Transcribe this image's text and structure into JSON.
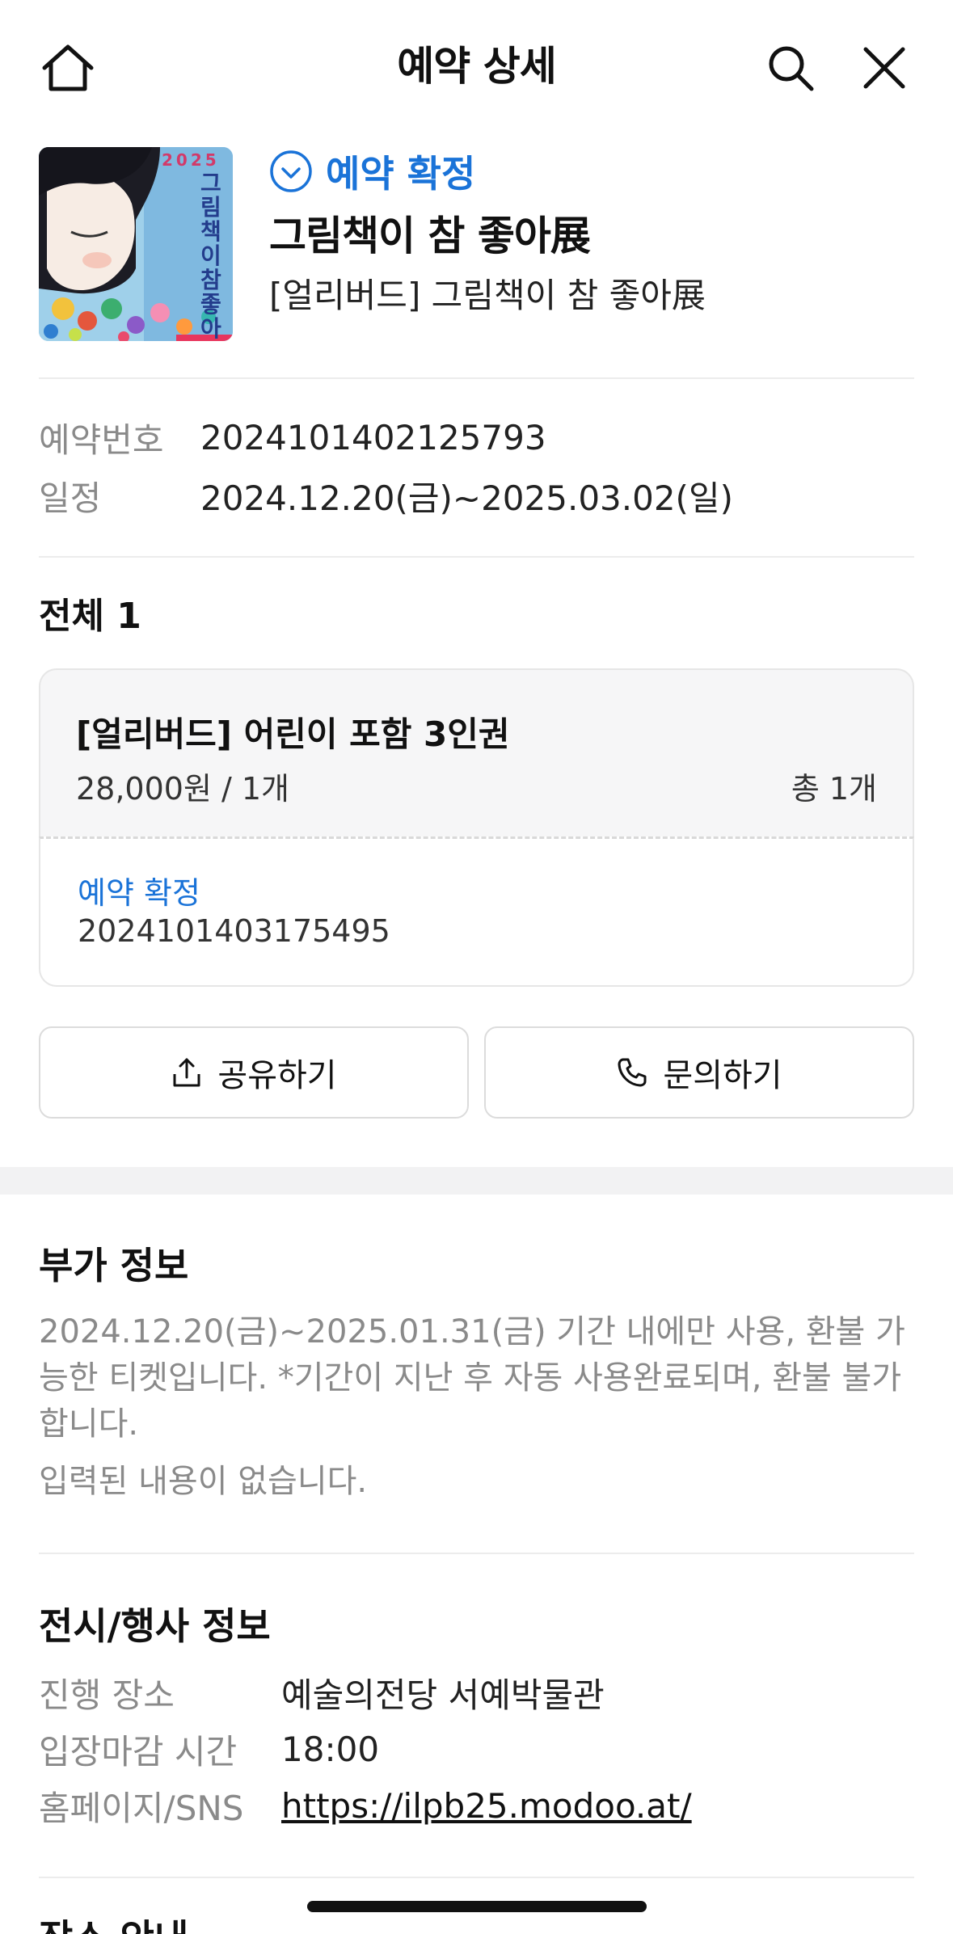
{
  "header": {
    "title": "예약 상세",
    "home_icon": "home-icon",
    "search_icon": "search-icon",
    "close_icon": "close-icon"
  },
  "summary": {
    "status": "예약 확정",
    "status_icon": "check-circle-icon",
    "title": "그림책이 참 좋아展",
    "subtitle": "[얼리버드] 그림책이 참 좋아展",
    "poster": {
      "year": "2025",
      "title": "그림책이 참 좋아"
    }
  },
  "booking": {
    "number_label": "예약번호",
    "number": "2024101402125793",
    "schedule_label": "일정",
    "schedule": "2024.12.20(금)~2025.03.02(일)"
  },
  "items": {
    "total_label": "전체 1",
    "ticket": {
      "name": "[얼리버드] 어린이 포함 3인권",
      "price": "28,000원 / 1개",
      "qty": "총 1개",
      "status": "예약 확정",
      "number": "2024101403175495"
    }
  },
  "actions": {
    "share": "공유하기",
    "contact": "문의하기"
  },
  "additional": {
    "title": "부가 정보",
    "text": "2024.12.20(금)~2025.01.31(금) 기간 내에만 사용, 환불 가능한 티켓입니다. *기간이 지난 후 자동 사용완료되며, 환불 불가합니다.",
    "empty": "입력된 내용이 없습니다."
  },
  "event": {
    "title": "전시/행사 정보",
    "venue_label": "진행 장소",
    "venue": "예술의전당 서예박물관",
    "deadline_label": "입장마감 시간",
    "deadline": "18:00",
    "homepage_label": "홈페이지/SNS",
    "homepage": "https://ilpb25.modoo.at/"
  },
  "next_section": {
    "title": "장소 안내"
  },
  "colors": {
    "accent": "#1a73d8",
    "label_gray": "#8a8a8a",
    "divider": "#ececec",
    "card_bg": "#f6f6f7"
  }
}
